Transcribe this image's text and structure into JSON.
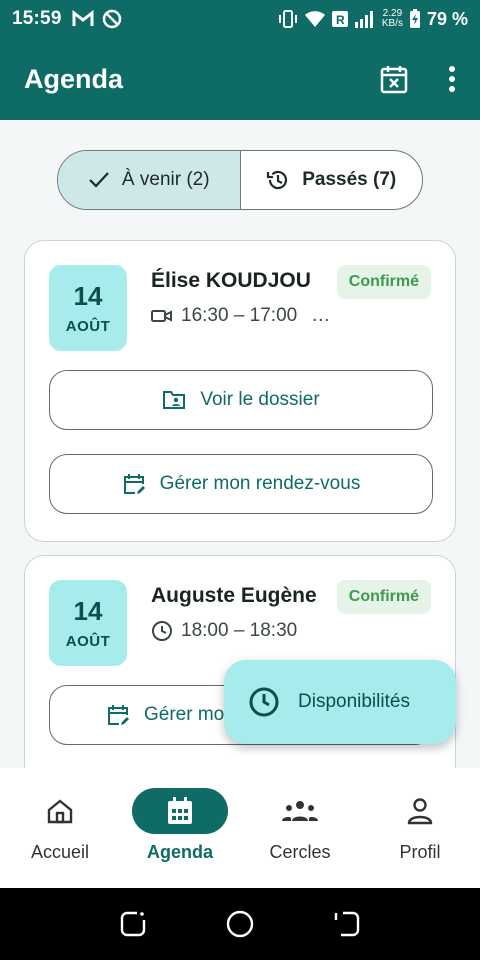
{
  "status_bar": {
    "time": "15:59",
    "speed_value": "2.29",
    "speed_unit": "KB/s",
    "battery": "79 %"
  },
  "app_bar": {
    "title": "Agenda",
    "icons": [
      "calendar-cancel-icon",
      "more-vert-icon"
    ]
  },
  "tabs": {
    "upcoming_label": "À venir (2)",
    "past_label": "Passés (7)"
  },
  "appointments": [
    {
      "day": "14",
      "month": "AOÛT",
      "name": "Élise KOUDJOU",
      "status": "Confirmé",
      "time": "16:30 – 17:00",
      "extra": "…",
      "time_icon": "video-icon",
      "buttons": [
        "Voir le dossier",
        "Gérer mon rendez-vous"
      ]
    },
    {
      "day": "14",
      "month": "AOÛT",
      "name": "Auguste Eugène",
      "status": "Confirmé",
      "time": "18:00 – 18:30",
      "time_icon": "clock-icon",
      "buttons": [
        "Gérer mo"
      ]
    }
  ],
  "fab": {
    "label": "Disponibilités"
  },
  "bottom_nav": [
    {
      "label": "Accueil",
      "icon": "home-icon"
    },
    {
      "label": "Agenda",
      "icon": "calendar-icon",
      "active": true
    },
    {
      "label": "Cercles",
      "icon": "groups-icon"
    },
    {
      "label": "Profil",
      "icon": "person-icon"
    }
  ],
  "colors": {
    "primary": "#0f6b66",
    "accent_light": "#a7ecec",
    "badge_bg": "#e5f3e8",
    "badge_text": "#3d9a4f"
  }
}
